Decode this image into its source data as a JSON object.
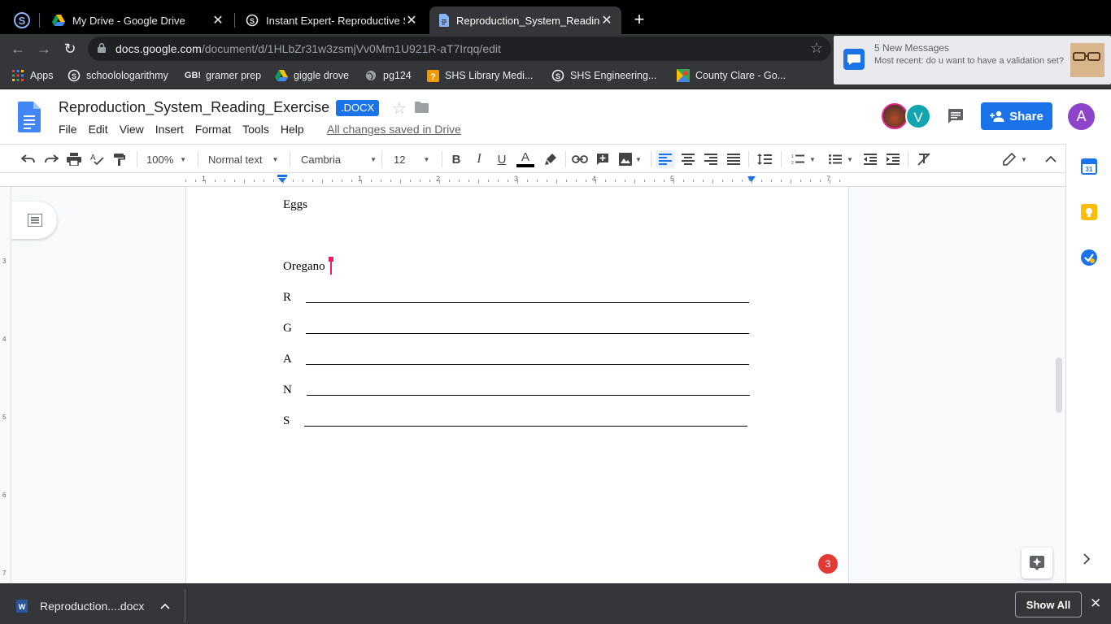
{
  "browser": {
    "tabs": [
      {
        "title": "My Drive - Google Drive",
        "icon": "google-drive-icon"
      },
      {
        "title": "Instant Expert- Reproductive S",
        "icon": "schoology-icon"
      },
      {
        "title": "Reproduction_System_Reading",
        "icon": "google-docs-icon",
        "active": true
      }
    ],
    "url_host": "docs.google.com",
    "url_path": "/document/d/1HLbZr31w3zsmjVv0Mm1U921R-aT7Irqq/edit",
    "bookmarks": [
      {
        "label": "Apps",
        "icon": "apps-grid-icon"
      },
      {
        "label": "schoolologarithmy",
        "icon": "schoology-icon"
      },
      {
        "label": "gramer prep",
        "icon": "gb-icon"
      },
      {
        "label": "giggle drove",
        "icon": "google-drive-icon"
      },
      {
        "label": "pg124",
        "icon": "globe-icon"
      },
      {
        "label": "SHS Library Medi...",
        "icon": "library-icon"
      },
      {
        "label": "SHS Engineering...",
        "icon": "schoology-icon"
      },
      {
        "label": "County Clare - Go...",
        "icon": "maps-icon"
      }
    ]
  },
  "notification": {
    "title": "5 New Messages",
    "body": "Most recent: do u want to have a validation set?"
  },
  "docs": {
    "title": "Reproduction_System_Reading_Exercise",
    "badge": ".DOCX",
    "menu": [
      "File",
      "Edit",
      "View",
      "Insert",
      "Format",
      "Tools",
      "Help"
    ],
    "saved_status": "All changes saved in Drive",
    "share_label": "Share",
    "avatar_v": "V",
    "avatar_a": "A"
  },
  "toolbar": {
    "zoom": "100%",
    "style": "Normal text",
    "font": "Cambria",
    "size": "12",
    "bold": "B",
    "italic": "I",
    "underline": "U",
    "text_color_letter": "A",
    "text_color": "#000000"
  },
  "ruler": {
    "numbers": [
      "1",
      "1",
      "2",
      "3",
      "4",
      "5",
      "6",
      "7"
    ],
    "vertical_numbers": [
      "3",
      "4",
      "5",
      "6",
      "7"
    ]
  },
  "document": {
    "line1": "Eggs",
    "line2": "Oregano",
    "acrostic": [
      "R",
      "G",
      "A",
      "N",
      "S"
    ]
  },
  "badge_count": "3",
  "download": {
    "filename": "Reproduction....docx",
    "show_all": "Show All"
  },
  "colors": {
    "accent": "#1a73e8",
    "cursor": "#e91e63",
    "badge": "#e53935"
  }
}
